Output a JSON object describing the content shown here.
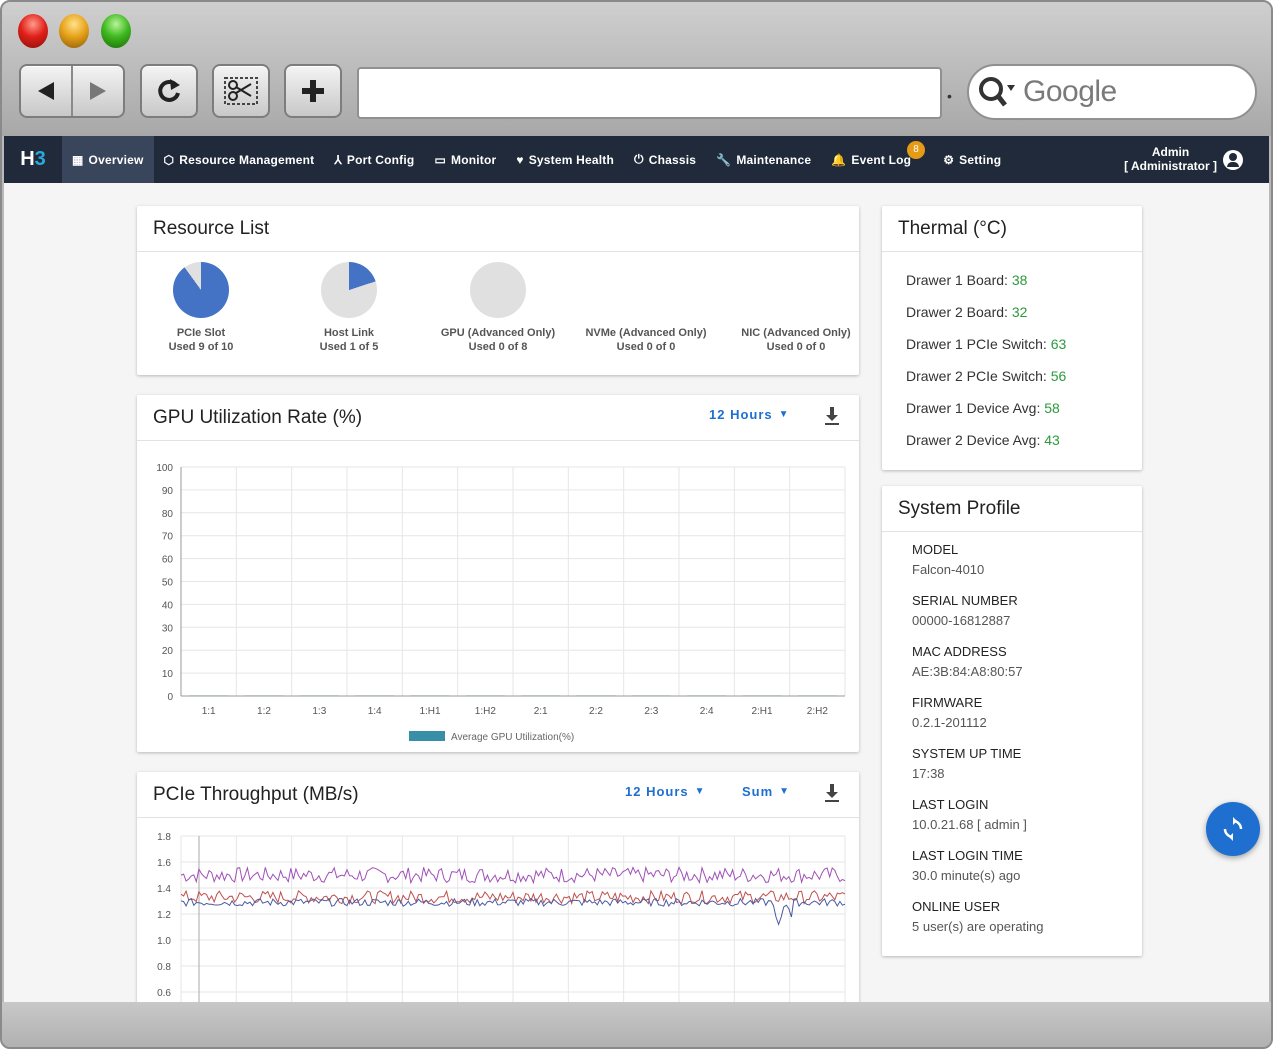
{
  "browser": {
    "search_placeholder": "Google"
  },
  "nav": {
    "logo": "H3",
    "items": [
      {
        "label": "Overview",
        "icon": "dashboard-icon"
      },
      {
        "label": "Resource Management",
        "icon": "box-icon"
      },
      {
        "label": "Port Config",
        "icon": "network-icon"
      },
      {
        "label": "Monitor",
        "icon": "monitor-icon"
      },
      {
        "label": "System Health",
        "icon": "heartbeat-icon"
      },
      {
        "label": "Chassis",
        "icon": "power-icon"
      },
      {
        "label": "Maintenance",
        "icon": "wrench-icon"
      },
      {
        "label": "Event Log",
        "icon": "bell-icon",
        "badge": "8"
      },
      {
        "label": "Setting",
        "icon": "gear-icon"
      }
    ],
    "user_name": "Admin",
    "user_role": "[ Administrator ]"
  },
  "resource_list": {
    "title": "Resource List",
    "items": [
      {
        "name": "PCIe Slot",
        "usage": "Used 9 of 10",
        "fraction": 0.9
      },
      {
        "name": "Host Link",
        "usage": "Used 1 of 5",
        "fraction": 0.2
      },
      {
        "name": "GPU (Advanced Only)",
        "usage": "Used 0 of 8",
        "fraction": 0
      },
      {
        "name": "NVMe (Advanced Only)",
        "usage": "Used 0 of 0",
        "fraction": 0
      },
      {
        "name": "NIC (Advanced Only)",
        "usage": "Used 0 of 0",
        "fraction": 0
      }
    ]
  },
  "gpu_chart_card": {
    "title": "GPU Utilization Rate (%)",
    "range": "12 Hours"
  },
  "pcie_chart_card": {
    "title": "PCIe Throughput (MB/s)",
    "range": "12 Hours",
    "aggregate": "Sum"
  },
  "chart_data": [
    {
      "type": "bar",
      "categories": [
        "1:1",
        "1:2",
        "1:3",
        "1:4",
        "1:H1",
        "1:H2",
        "2:1",
        "2:2",
        "2:3",
        "2:4",
        "2:H1",
        "2:H2"
      ],
      "series": [
        {
          "name": "Average GPU Utilization(%)",
          "values": [
            0,
            0,
            0,
            0,
            0,
            0,
            0,
            0,
            0,
            0,
            0,
            0
          ],
          "color": "#3a8fa8"
        }
      ],
      "ylim": [
        0,
        100
      ],
      "yticks": [
        0,
        10,
        20,
        30,
        40,
        50,
        60,
        70,
        80,
        90,
        100
      ],
      "grid": true,
      "legend": "bottom"
    },
    {
      "type": "line",
      "yticks": [
        "0.6",
        "0.8",
        "1.0",
        "1.2",
        "1.4",
        "1.6",
        "1.8"
      ],
      "ylim": [
        0.6,
        1.8
      ],
      "series": [
        {
          "color": "#a050b8",
          "base": 1.5,
          "noise": 0.06
        },
        {
          "color": "#c0504d",
          "base": 1.33,
          "noise": 0.05
        },
        {
          "color": "#4a5aa0",
          "base": 1.29,
          "noise": 0.03
        }
      ],
      "grid": true
    }
  ],
  "thermal": {
    "title": "Thermal (°C)",
    "items": [
      {
        "label": "Drawer 1 Board:",
        "value": "38"
      },
      {
        "label": "Drawer 2 Board:",
        "value": "32"
      },
      {
        "label": "Drawer 1 PCIe Switch:",
        "value": "63"
      },
      {
        "label": "Drawer 2 PCIe Switch:",
        "value": "56"
      },
      {
        "label": "Drawer 1 Device Avg:",
        "value": "58"
      },
      {
        "label": "Drawer 2 Device Avg:",
        "value": "43"
      }
    ]
  },
  "system_profile": {
    "title": "System Profile",
    "items": [
      {
        "key": "MODEL",
        "value": "Falcon-4010"
      },
      {
        "key": "SERIAL NUMBER",
        "value": "00000-16812887"
      },
      {
        "key": "MAC ADDRESS",
        "value": "AE:3B:84:A8:80:57"
      },
      {
        "key": "FIRMWARE",
        "value": "0.2.1-201112"
      },
      {
        "key": "SYSTEM UP TIME",
        "value": "17:38"
      },
      {
        "key": "LAST LOGIN",
        "value": "10.0.21.68 [ admin ]"
      },
      {
        "key": "LAST LOGIN TIME",
        "value": "30.0 minute(s) ago"
      },
      {
        "key": "ONLINE USER",
        "value": "5 user(s) are operating"
      }
    ]
  },
  "colors": {
    "nav_bg": "#202a3a",
    "accent": "#1e6fd0",
    "pie_fill": "#4472c4",
    "pie_empty": "#e0e0e0",
    "good_value": "#2c9a3c"
  }
}
